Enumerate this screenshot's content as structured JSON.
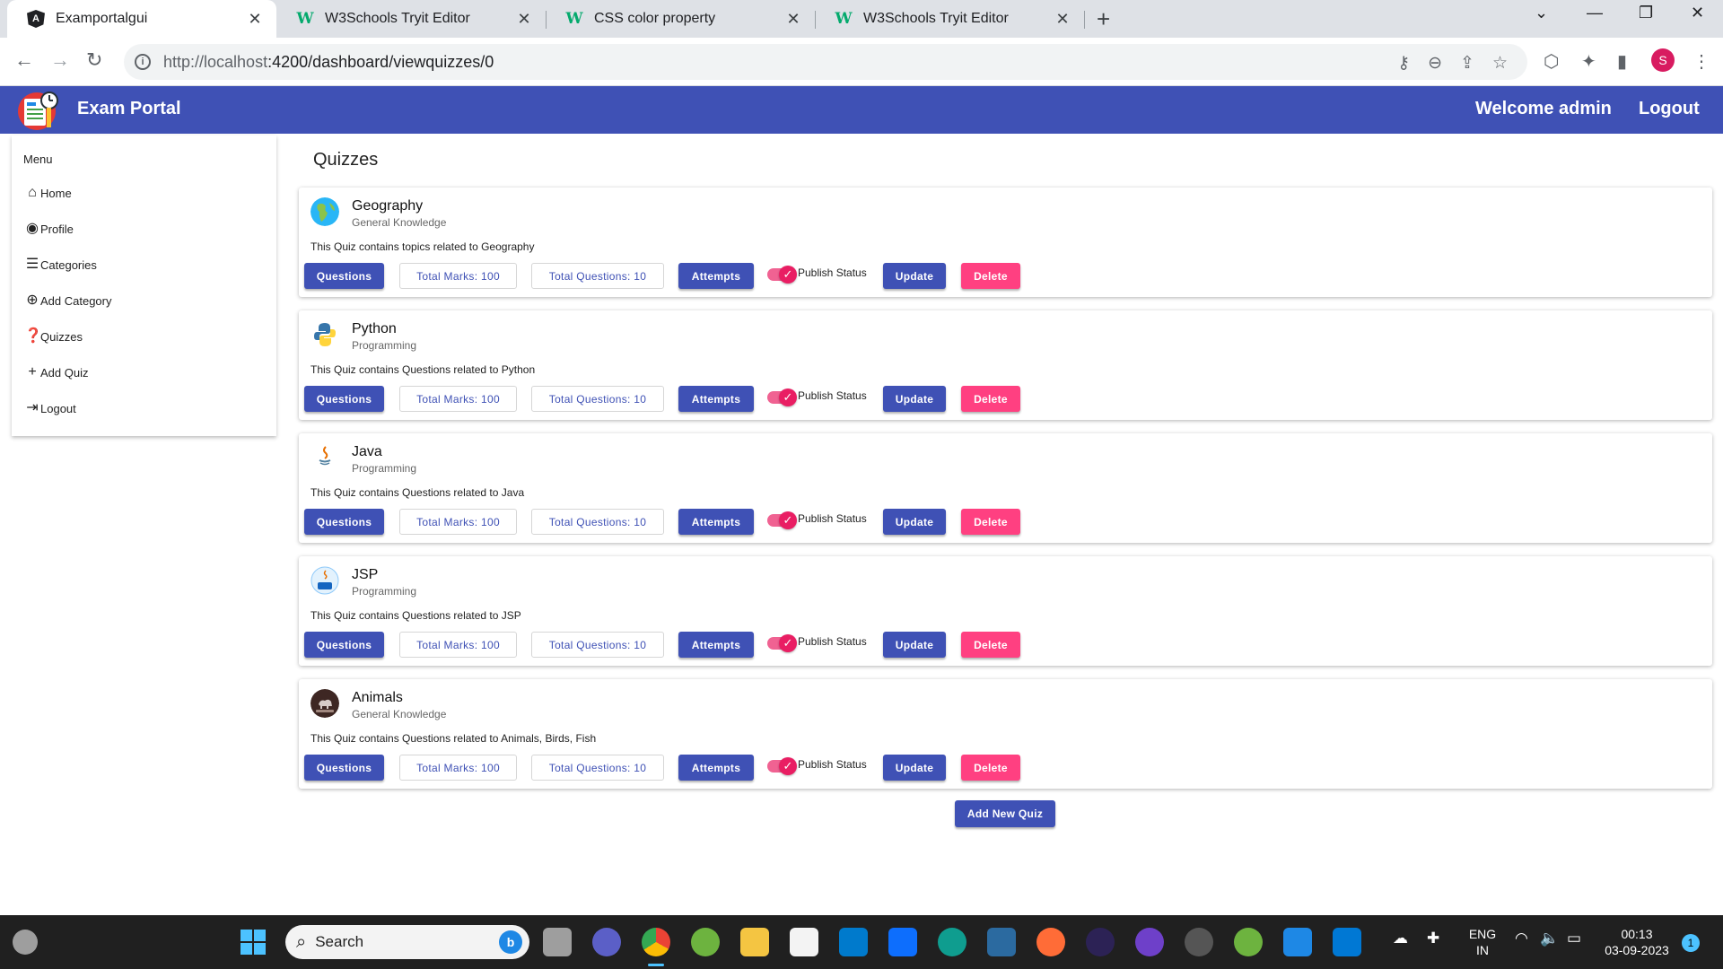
{
  "browser": {
    "tabs": [
      {
        "title": "Examportalgui",
        "favicon": "angular-icon"
      },
      {
        "title": "W3Schools Tryit Editor",
        "favicon": "w3schools-icon"
      },
      {
        "title": "CSS color property",
        "favicon": "w3schools-icon"
      },
      {
        "title": "W3Schools Tryit Editor",
        "favicon": "w3schools-icon"
      }
    ],
    "url_host": "http://localhost",
    "url_rest": ":4200/dashboard/viewquizzes/0",
    "profile_initial": "S"
  },
  "toolbar": {
    "title": "Exam Portal",
    "welcome": "Welcome admin",
    "logout": "Logout",
    "color": "#3f51b5"
  },
  "sidebar": {
    "menu_title": "Menu",
    "items": [
      {
        "label": "Home",
        "icon": "home-icon"
      },
      {
        "label": "Profile",
        "icon": "account-circle-icon"
      },
      {
        "label": "Categories",
        "icon": "list-icon"
      },
      {
        "label": "Add Category",
        "icon": "add-circle-icon"
      },
      {
        "label": "Quizzes",
        "icon": "quiz-icon"
      },
      {
        "label": "Add Quiz",
        "icon": "plus-icon"
      },
      {
        "label": "Logout",
        "icon": "logout-icon"
      }
    ]
  },
  "main": {
    "title": "Quizzes",
    "add_button": "Add New Quiz",
    "labels": {
      "questions": "Questions",
      "marks": "Total Marks: 100",
      "count": "Total Questions: 10",
      "attempts": "Attempts",
      "publish": "Publish Status",
      "update": "Update",
      "delete": "Delete"
    },
    "quizzes": [
      {
        "title": "Geography",
        "category": "General Knowledge",
        "description": "This Quiz contains topics related to Geography",
        "icon": "globe-icon",
        "published": true
      },
      {
        "title": "Python",
        "category": "Programming",
        "description": "This Quiz contains Questions related to Python",
        "icon": "python-logo-icon",
        "published": true
      },
      {
        "title": "Java",
        "category": "Programming",
        "description": "This Quiz contains Questions related to Java",
        "icon": "java-logo-icon",
        "published": true
      },
      {
        "title": "JSP",
        "category": "Programming",
        "description": "This Quiz contains Questions related to JSP",
        "icon": "jsp-logo-icon",
        "published": true
      },
      {
        "title": "Animals",
        "category": "General Knowledge",
        "description": "This Quiz contains Questions related to Animals, Birds, Fish",
        "icon": "animal-quiz-icon",
        "published": true
      }
    ],
    "accent": "#ff4081"
  },
  "taskbar": {
    "search_placeholder": "Search",
    "lang_line1": "ENG",
    "lang_line2": "IN",
    "time": "00:13",
    "date": "03-09-2023",
    "notifications": "1"
  }
}
